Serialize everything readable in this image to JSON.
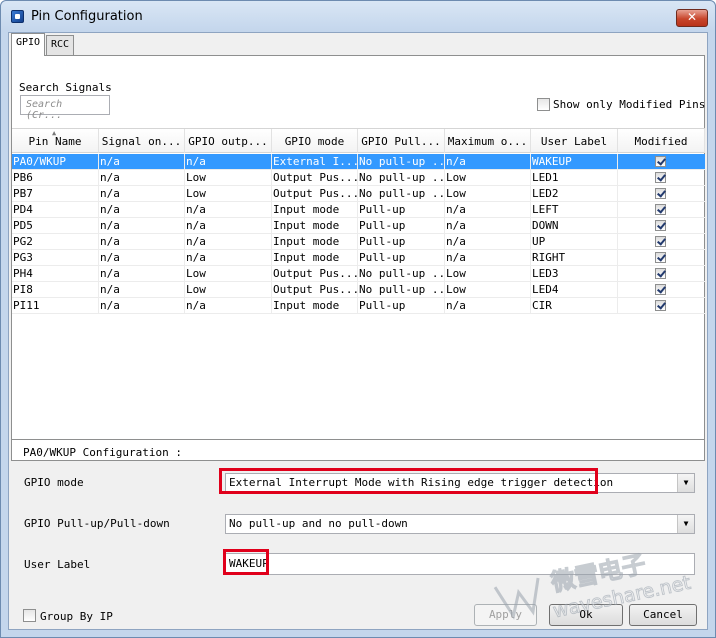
{
  "window": {
    "title": "Pin Configuration",
    "close_glyph": "✕"
  },
  "tabs": [
    {
      "label": "GPIO",
      "active": true
    },
    {
      "label": "RCC",
      "active": false
    }
  ],
  "search": {
    "label": "Search Signals",
    "placeholder": "Search (Cr..."
  },
  "show_modified": {
    "label": "Show only Modified Pins",
    "checked": false
  },
  "table": {
    "columns": [
      "Pin Name",
      "Signal on...",
      "GPIO outp...",
      "GPIO mode",
      "GPIO Pull...",
      "Maximum o...",
      "User Label",
      "Modified"
    ],
    "rows": [
      {
        "pin": "PA0/WKUP",
        "signal": "n/a",
        "output": "n/a",
        "mode": "External I...",
        "pull": "No pull-up ...",
        "speed": "n/a",
        "label": "WAKEUP",
        "modified": true,
        "selected": true
      },
      {
        "pin": "PB6",
        "signal": "n/a",
        "output": "Low",
        "mode": "Output Pus...",
        "pull": "No pull-up ...",
        "speed": "Low",
        "label": "LED1",
        "modified": true
      },
      {
        "pin": "PB7",
        "signal": "n/a",
        "output": "Low",
        "mode": "Output Pus...",
        "pull": "No pull-up ...",
        "speed": "Low",
        "label": "LED2",
        "modified": true
      },
      {
        "pin": "PD4",
        "signal": "n/a",
        "output": "n/a",
        "mode": "Input mode",
        "pull": "Pull-up",
        "speed": "n/a",
        "label": "LEFT",
        "modified": true
      },
      {
        "pin": "PD5",
        "signal": "n/a",
        "output": "n/a",
        "mode": "Input mode",
        "pull": "Pull-up",
        "speed": "n/a",
        "label": "DOWN",
        "modified": true
      },
      {
        "pin": "PG2",
        "signal": "n/a",
        "output": "n/a",
        "mode": "Input mode",
        "pull": "Pull-up",
        "speed": "n/a",
        "label": "UP",
        "modified": true
      },
      {
        "pin": "PG3",
        "signal": "n/a",
        "output": "n/a",
        "mode": "Input mode",
        "pull": "Pull-up",
        "speed": "n/a",
        "label": "RIGHT",
        "modified": true
      },
      {
        "pin": "PH4",
        "signal": "n/a",
        "output": "Low",
        "mode": "Output Pus...",
        "pull": "No pull-up ...",
        "speed": "Low",
        "label": "LED3",
        "modified": true
      },
      {
        "pin": "PI8",
        "signal": "n/a",
        "output": "Low",
        "mode": "Output Pus...",
        "pull": "No pull-up ...",
        "speed": "Low",
        "label": "LED4",
        "modified": true
      },
      {
        "pin": "PI11",
        "signal": "n/a",
        "output": "n/a",
        "mode": "Input mode",
        "pull": "Pull-up",
        "speed": "n/a",
        "label": "CIR",
        "modified": true
      }
    ]
  },
  "config": {
    "title": "PA0/WKUP Configuration :",
    "gpio_mode_label": "GPIO mode",
    "gpio_mode_value": "External Interrupt Mode with Rising edge trigger detection",
    "pull_label": "GPIO Pull-up/Pull-down",
    "pull_value": "No pull-up and no pull-down",
    "user_label_label": "User Label",
    "user_label_value": "WAKEUP"
  },
  "footer": {
    "group_by_label": "Group By IP",
    "apply_label": "Apply",
    "ok_label": "Ok",
    "cancel_label": "Cancel"
  },
  "watermark": {
    "cn_text": "微雪电子",
    "en_text": "waveshare.net"
  },
  "colors": {
    "selection": "#3399ff",
    "highlight_box": "#e0001b"
  }
}
